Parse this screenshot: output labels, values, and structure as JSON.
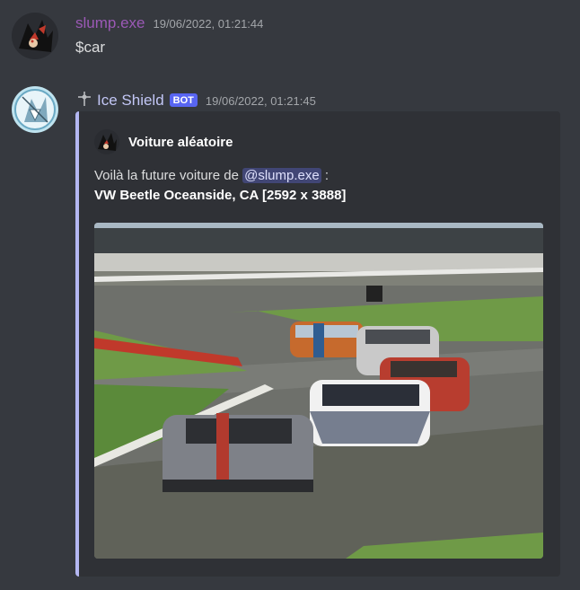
{
  "messages": [
    {
      "username": "slump.exe",
      "timestamp": "19/06/2022, 01:21:44",
      "text": "$car",
      "username_color": "#9b59b6"
    },
    {
      "username": "Ice Shield",
      "bot_tag": "BOT",
      "timestamp": "19/06/2022, 01:21:45",
      "username_color": "#c2c6f5",
      "embed": {
        "author": "Voiture aléatoire",
        "desc_prefix": "Voilà la future voiture de ",
        "mention": "@slump.exe",
        "desc_suffix": " :",
        "car_title": "VW Beetle Oceanside, CA [2592 x 3888]",
        "accent_color": "#b4b7f2",
        "image": "race-track-supercars-photo"
      }
    }
  ],
  "colors": {
    "background": "#36393f",
    "embed_bg": "#2f3136",
    "bot_badge": "#5865f2",
    "mention_bg": "#414675"
  }
}
